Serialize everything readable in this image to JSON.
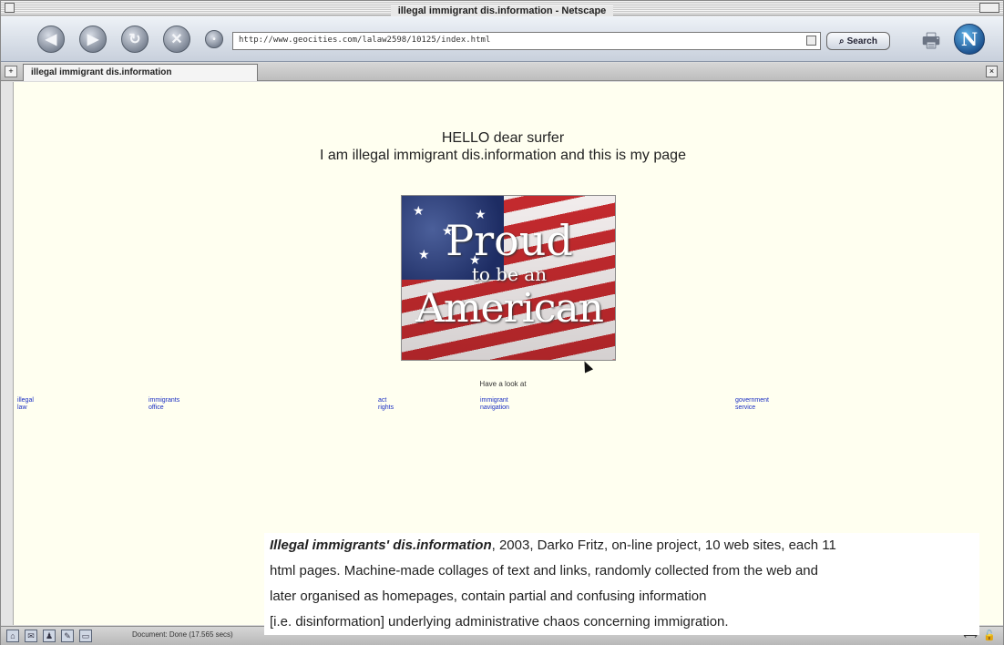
{
  "window": {
    "title": "illegal immigrant dis.information - Netscape"
  },
  "toolbar": {
    "back_glyph": "◀",
    "forward_glyph": "▶",
    "reload_glyph": "↻",
    "stop_glyph": "✕",
    "home_glyph": "•",
    "url": "http://www.geocities.com/lalaw2598/10125/index.html",
    "search_label": "Search",
    "search_glyph": "⌕",
    "print_glyph": "🖶",
    "logo_letter": "N"
  },
  "tabs": {
    "new_tab_glyph": "+",
    "active_tab_label": "illegal immigrant dis.information",
    "close_glyph": "×"
  },
  "page": {
    "greeting_line1": "HELLO dear surfer",
    "greeting_line2": "I am illegal immigrant dis.information and this is my page",
    "banner_line1": "Proud",
    "banner_line2": "to be an",
    "banner_line3": "American",
    "have_a_look": "Have a look at",
    "links": [
      {
        "line1": "illegal",
        "line2": "law"
      },
      {
        "line1": "immigrants",
        "line2": "office"
      },
      {
        "line1": "act",
        "line2": "rights"
      },
      {
        "line1": "immigrant",
        "line2": "navigation"
      },
      {
        "line1": "government",
        "line2": "service"
      }
    ]
  },
  "caption": {
    "title": "Illegal immigrants' dis.information",
    "text_line1": ", 2003, Darko Fritz, on-line project, 10 web sites, each 11",
    "text_line2": "html pages. Machine-made collages of text and links, randomly collected from the web and",
    "text_line3": "later organised as homepages, contain partial and confusing information",
    "text_line4": "[i.e. disinformation] underlying administrative chaos concerning immigration."
  },
  "status": {
    "text": "Document: Done (17.565 secs)",
    "right_glyph": "⟷",
    "lock_glyph": "🔓"
  },
  "colors": {
    "page_background": "#fffff0",
    "link": "#1a2ec2",
    "chrome": "#c8d0dc"
  },
  "icons": [
    "back-icon",
    "forward-icon",
    "reload-icon",
    "stop-icon",
    "home-icon",
    "search-icon",
    "print-icon",
    "netscape-logo",
    "new-tab-icon",
    "close-tab-icon",
    "lock-icon"
  ]
}
